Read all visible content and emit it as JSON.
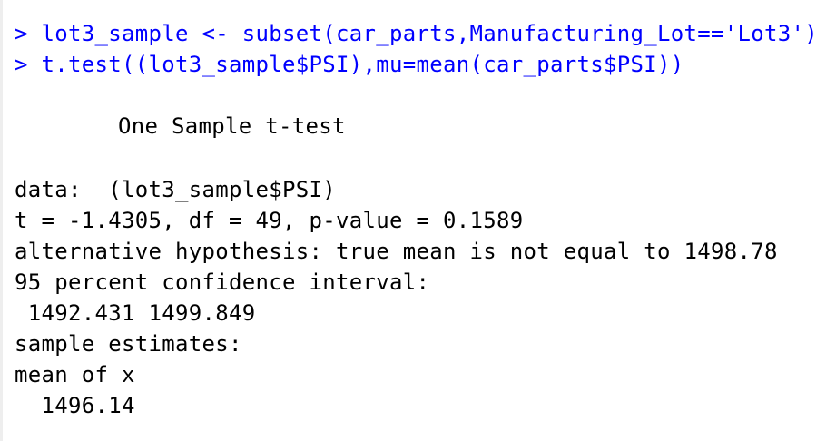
{
  "console": {
    "commands": [
      {
        "prompt": ">",
        "text": "lot3_sample <- subset(car_parts,Manufacturing_Lot=='Lot3')"
      },
      {
        "prompt": ">",
        "text": "t.test((lot3_sample$PSI),mu=mean(car_parts$PSI))"
      }
    ],
    "output": {
      "title": "One Sample t-test",
      "data_line": "data:  (lot3_sample$PSI)",
      "stats_line": "t = -1.4305, df = 49, p-value = 0.1589",
      "alt_line": "alternative hypothesis: true mean is not equal to 1498.78",
      "ci_label": "95 percent confidence interval:",
      "ci_values": " 1492.431 1499.849",
      "est_label": "sample estimates:",
      "est_name": "mean of x",
      "est_value": "  1496.14"
    },
    "colors": {
      "command": "#0000ff",
      "output": "#000000",
      "background": "#ffffff"
    }
  }
}
